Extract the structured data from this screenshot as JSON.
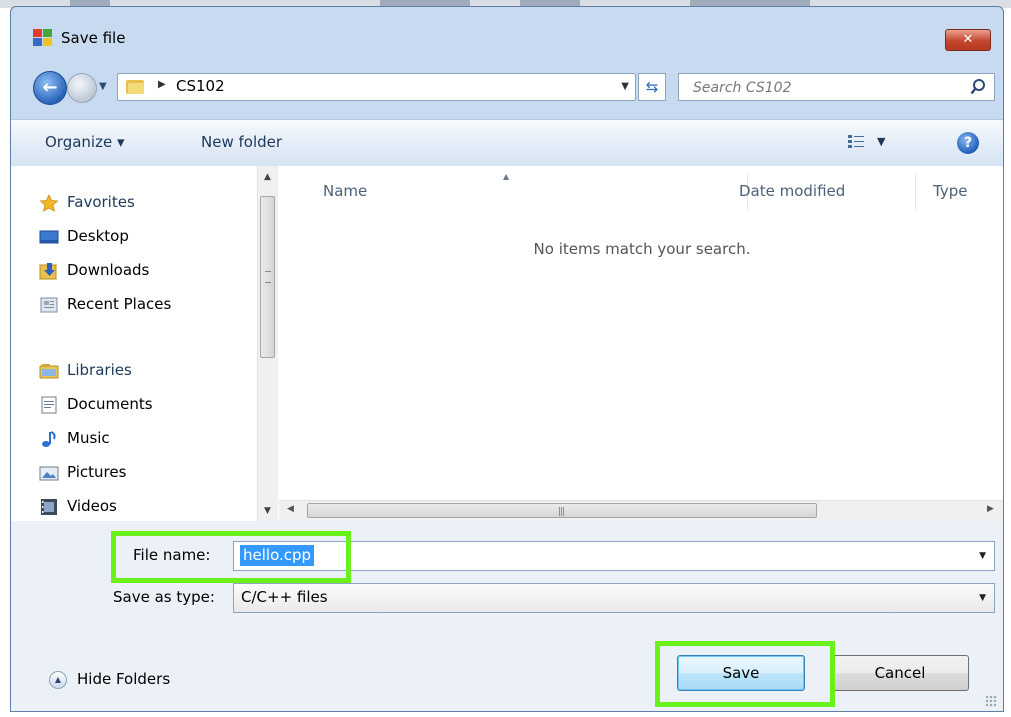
{
  "window": {
    "title": "Save file",
    "close_label": "✕"
  },
  "nav": {
    "back_icon": "back-arrow-icon",
    "forward_icon": "forward-arrow-icon"
  },
  "address": {
    "crumb": "CS102"
  },
  "search": {
    "placeholder": "Search CS102"
  },
  "toolbar": {
    "organize_label": "Organize ▾",
    "new_folder_label": "New folder",
    "help_label": "?"
  },
  "sidebar": {
    "items": [
      {
        "label": "Favorites",
        "icon": "star-icon"
      },
      {
        "label": "Desktop",
        "icon": "desktop-icon"
      },
      {
        "label": "Downloads",
        "icon": "downloads-icon"
      },
      {
        "label": "Recent Places",
        "icon": "recent-places-icon"
      },
      {
        "label": "Libraries",
        "icon": "libraries-icon"
      },
      {
        "label": "Documents",
        "icon": "documents-icon"
      },
      {
        "label": "Music",
        "icon": "music-icon"
      },
      {
        "label": "Pictures",
        "icon": "pictures-icon"
      },
      {
        "label": "Videos",
        "icon": "videos-icon"
      }
    ]
  },
  "file_list": {
    "columns": [
      "Name",
      "Date modified",
      "Type"
    ],
    "empty_message": "No items match your search."
  },
  "form": {
    "filename_label": "File name:",
    "filename_value": "hello.cpp",
    "type_label": "Save as type:",
    "type_value": "C/C++ files"
  },
  "footer": {
    "hide_folders_label": "Hide Folders"
  },
  "buttons": {
    "save_label": "Save",
    "cancel_label": "Cancel"
  },
  "colors": {
    "highlight_box": "#6af01a",
    "selection": "#3399ff",
    "window_frame": "#c8daf0"
  }
}
